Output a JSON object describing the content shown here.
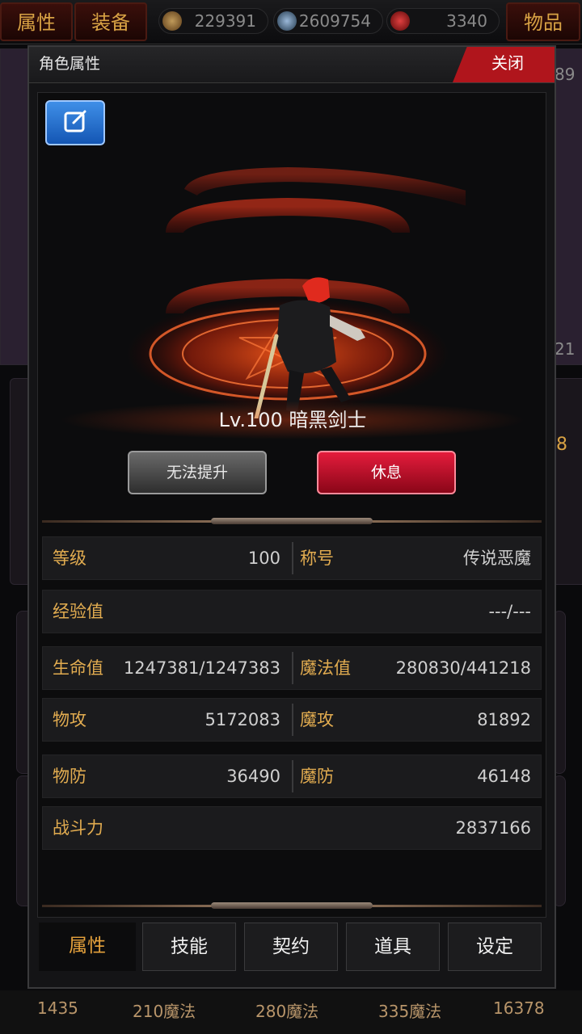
{
  "top_bar": {
    "attr_label": "属性",
    "equip_label": "装备",
    "items_label": "物品",
    "resources": [
      {
        "icon": "gold-coin-icon",
        "value": "229391"
      },
      {
        "icon": "skull-orb-icon",
        "value": "2609754"
      },
      {
        "icon": "blood-orb-icon",
        "value": "3340"
      }
    ]
  },
  "background": {
    "right_number_top": "89",
    "right_number_mid": "21",
    "right_number_3": "8",
    "bottom_values": [
      "1435",
      "210魔法",
      "280魔法",
      "335魔法",
      "16378"
    ]
  },
  "modal": {
    "title": "角色属性",
    "close_label": "关闭",
    "hero": {
      "name": "Lv.100 暗黑剑士"
    },
    "buttons": {
      "upgrade_label": "无法提升",
      "rest_label": "休息"
    },
    "stats": {
      "level_label": "等级",
      "level_value": "100",
      "title_label": "称号",
      "title_value": "传说恶魔",
      "exp_label": "经验值",
      "exp_value": "---/---",
      "hp_label": "生命值",
      "hp_value": "1247381/1247383",
      "mp_label": "魔法值",
      "mp_value": "280830/441218",
      "patk_label": "物攻",
      "patk_value": "5172083",
      "matk_label": "魔攻",
      "matk_value": "81892",
      "pdef_label": "物防",
      "pdef_value": "36490",
      "mdef_label": "魔防",
      "mdef_value": "46148",
      "power_label": "战斗力",
      "power_value": "2837166"
    },
    "tabs": [
      "属性",
      "技能",
      "契约",
      "道具",
      "设定"
    ]
  },
  "colors": {
    "accent_gold": "#e2ac50",
    "close_red": "#b0151c",
    "rest_red": "#e41c3c",
    "edit_blue": "#2a6fd0"
  }
}
